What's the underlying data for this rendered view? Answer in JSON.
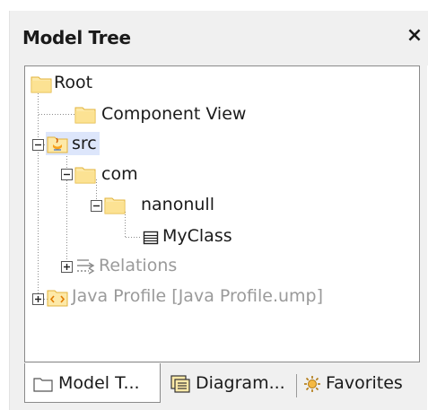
{
  "panel": {
    "title": "Model Tree",
    "close_glyph": "×"
  },
  "tree": {
    "root": "Root",
    "component_view": "Component View",
    "src": "src",
    "com": "com",
    "nanonull": "nanonull",
    "myclass": "MyClass",
    "relations": "Relations",
    "java_profile": "Java Profile [Java Profile.ump]"
  },
  "tabs": [
    {
      "label": "Model T...",
      "icon": "folder-icon",
      "active": true
    },
    {
      "label": "Diagram...",
      "icon": "diagram-list-icon",
      "active": false
    },
    {
      "label": "Favorites",
      "icon": "favorites-icon",
      "active": false
    }
  ],
  "colors": {
    "folder_fill": "#fde9a8",
    "folder_stroke": "#e2b33b",
    "selection": "#dde6fb",
    "java_badge": "#f7a21c"
  }
}
